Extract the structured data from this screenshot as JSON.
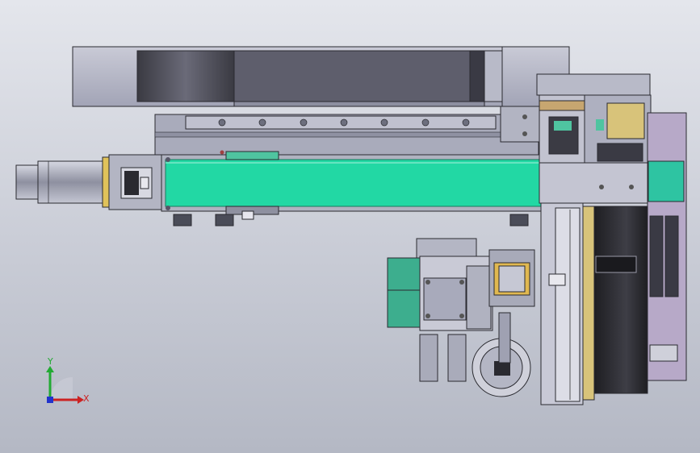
{
  "viewport": {
    "background_top": "#e4e6ec",
    "background_bottom": "#b4b8c4"
  },
  "palette": {
    "steel": "#a6a8b8",
    "steel_light": "#c3c4d2",
    "steel_dark": "#7d7f90",
    "teal": "#22d8a4",
    "teal_dark": "#1aa67e",
    "green_motor": "#3dae8e",
    "lavender": "#b7a9c8",
    "black_part": "#2c2c30",
    "brass": "#d8c37a",
    "outline": "#2a2a30"
  },
  "triad": {
    "x_label": "X",
    "y_label": "Y",
    "x_color": "#cc2222",
    "y_color": "#22aa33",
    "z_color": "#2233cc"
  }
}
